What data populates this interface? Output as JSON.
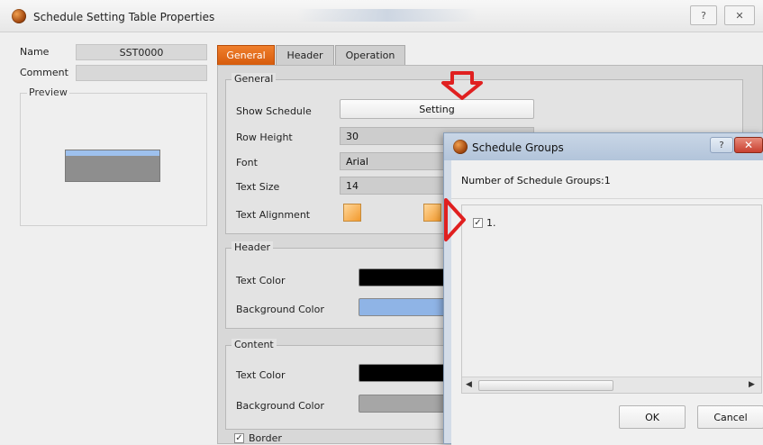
{
  "window": {
    "title": "Schedule Setting Table Properties",
    "help_label": "?",
    "close_label": "✕"
  },
  "left": {
    "name_label": "Name",
    "name_value": "SST0000",
    "comment_label": "Comment",
    "comment_value": "",
    "preview_label": "Preview"
  },
  "tabs": [
    {
      "label": "General",
      "active": true
    },
    {
      "label": "Header",
      "active": false
    },
    {
      "label": "Operation",
      "active": false
    }
  ],
  "general": {
    "section_title": "General",
    "show_schedule_label": "Show Schedule",
    "setting_button": "Setting",
    "row_height_label": "Row Height",
    "row_height_value": "30",
    "font_label": "Font",
    "font_value": "Arial",
    "text_size_label": "Text Size",
    "text_size_value": "14",
    "text_alignment_label": "Text Alignment"
  },
  "header_section": {
    "title": "Header",
    "text_color_label": "Text Color",
    "bg_color_label": "Background Color",
    "text_color": "#000000",
    "bg_color": "#8fb4e6"
  },
  "content_section": {
    "title": "Content",
    "text_color_label": "Text Color",
    "bg_color_label": "Background Color",
    "text_color": "#000000",
    "bg_color": "#a6a6a6"
  },
  "border": {
    "label": "Border",
    "checked": true
  },
  "dialog": {
    "title": "Schedule Groups",
    "count_label": "Number of Schedule Groups:1",
    "items": [
      {
        "label": "1.",
        "checked": true
      }
    ],
    "ok": "OK",
    "cancel": "Cancel"
  },
  "annotation_color": "#e02020"
}
